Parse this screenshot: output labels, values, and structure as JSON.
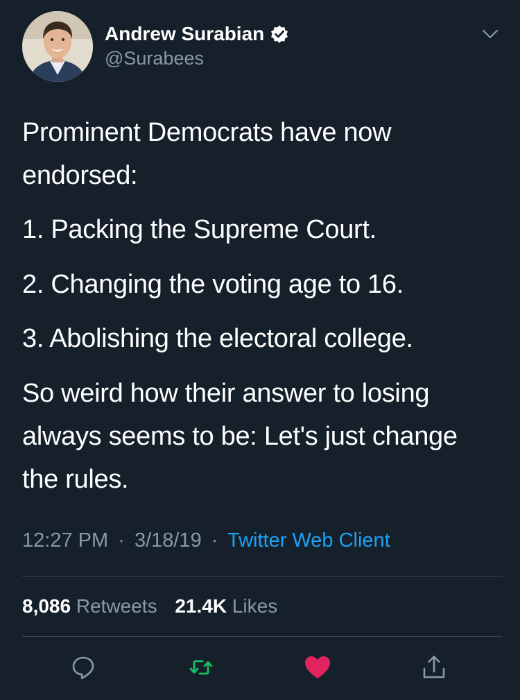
{
  "user": {
    "display_name": "Andrew Surabian",
    "handle": "@Surabees",
    "verified": true
  },
  "tweet": {
    "lines": [
      "Prominent Democrats have now",
      "endorsed:",
      "1. Packing the Supreme Court.",
      "2. Changing the voting age to 16.",
      "3. Abolishing the electoral college.",
      "So weird how their answer to losing",
      "always seems to be: Let's just change",
      "the rules."
    ]
  },
  "meta": {
    "time": "12:27 PM",
    "separator": "·",
    "date": "3/18/19",
    "source": "Twitter Web Client"
  },
  "stats": {
    "retweets_count": "8,086",
    "retweets_label": "Retweets",
    "likes_count": "21.4K",
    "likes_label": "Likes"
  },
  "actions": {
    "reply_icon": "reply-icon",
    "retweet_icon": "retweet-icon",
    "like_icon": "heart-icon",
    "share_icon": "share-icon"
  },
  "colors": {
    "background": "#15202b",
    "text": "#ffffff",
    "secondary_text": "#8899a6",
    "link": "#1da1f2",
    "retweet": "#17bf63",
    "like": "#e0245e",
    "divider": "#38444d"
  }
}
